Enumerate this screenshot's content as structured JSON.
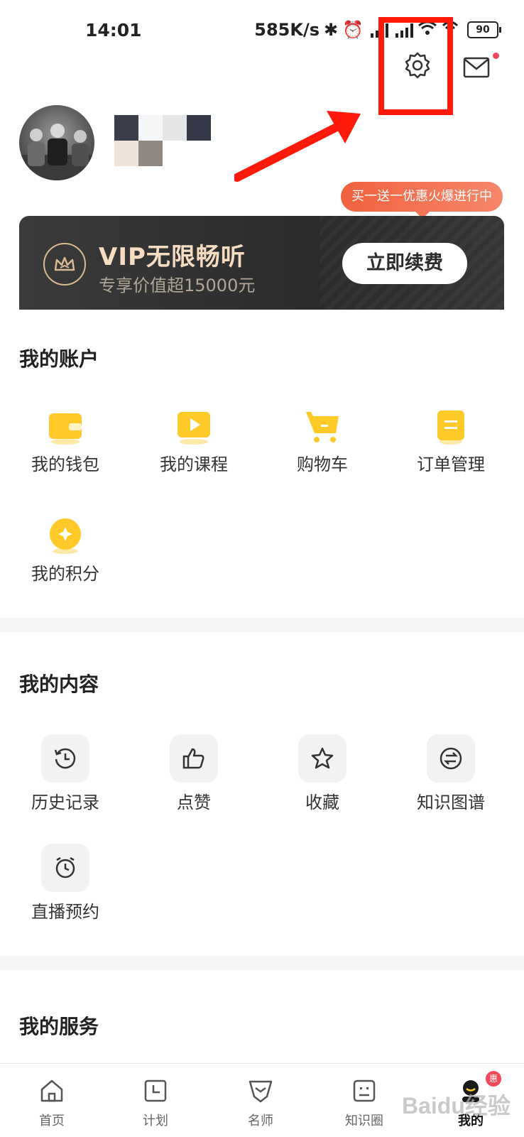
{
  "status_bar": {
    "time": "14:01",
    "speed": "585K/s",
    "battery": "90"
  },
  "header": {
    "settings_icon": "gear-icon",
    "message_icon": "mail-icon"
  },
  "profile": {
    "avatar": "avatar-photo"
  },
  "promo": {
    "bubble": "买一送一优惠火爆进行中",
    "vip_title": "VIP无限畅听",
    "vip_subtitle": "专享价值超15000元",
    "renew_button": "立即续费"
  },
  "account": {
    "title": "我的账户",
    "items": [
      {
        "label": "我的钱包",
        "icon": "wallet-icon"
      },
      {
        "label": "我的课程",
        "icon": "course-icon"
      },
      {
        "label": "购物车",
        "icon": "cart-icon"
      },
      {
        "label": "订单管理",
        "icon": "order-icon"
      },
      {
        "label": "我的积分",
        "icon": "points-icon"
      }
    ]
  },
  "content": {
    "title": "我的内容",
    "items": [
      {
        "label": "历史记录",
        "icon": "history-icon"
      },
      {
        "label": "点赞",
        "icon": "thumbs-up-icon"
      },
      {
        "label": "收藏",
        "icon": "star-icon"
      },
      {
        "label": "知识图谱",
        "icon": "exchange-icon"
      },
      {
        "label": "直播预约",
        "icon": "alarm-clock-icon"
      }
    ]
  },
  "services": {
    "title": "我的服务"
  },
  "bottom_nav": {
    "items": [
      {
        "label": "首页",
        "icon": "home-icon"
      },
      {
        "label": "计划",
        "icon": "plan-icon"
      },
      {
        "label": "名师",
        "icon": "teacher-icon"
      },
      {
        "label": "知识圈",
        "icon": "circle-icon"
      },
      {
        "label": "我的",
        "icon": "profile-icon"
      }
    ],
    "badge": "惠"
  },
  "watermark": "Baidu经验"
}
